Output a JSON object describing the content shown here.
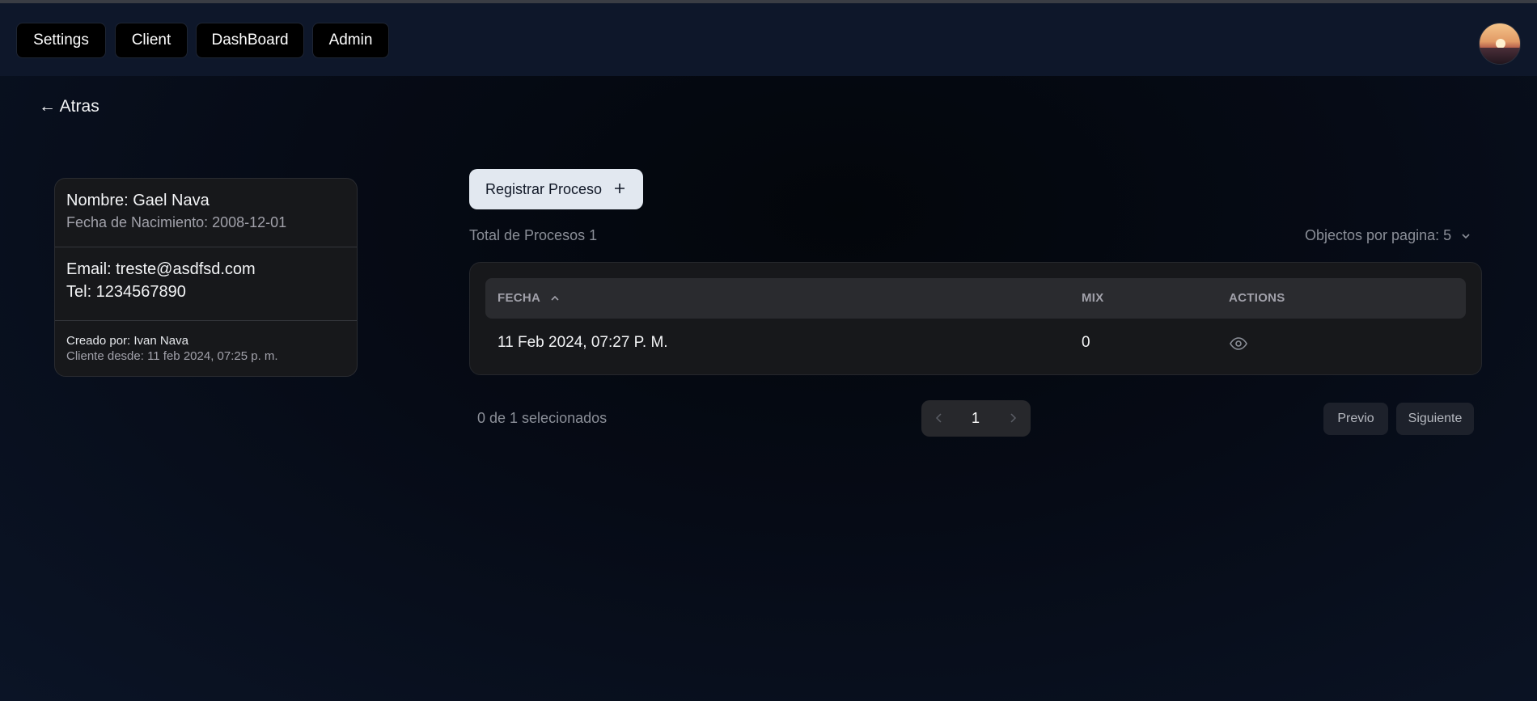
{
  "nav": {
    "buttons": [
      "Settings",
      "Client",
      "DashBoard",
      "Admin"
    ]
  },
  "back_link": "← Atras",
  "client_card": {
    "nombre": "Nombre: Gael Nava",
    "fecha_nacimiento": "Fecha de Nacimiento: 2008-12-01",
    "email": "Email: treste@asdfsd.com",
    "tel": "Tel: 1234567890",
    "creado_por": "Creado por: Ivan Nava",
    "cliente_desde": "Cliente desde: 11 feb 2024, 07:25 p. m."
  },
  "register_button": {
    "label": "Registrar Proceso",
    "icon": "plus-icon"
  },
  "total_label": "Total de Procesos 1",
  "per_page_label": "Objectos por pagina: 5",
  "table": {
    "headers": {
      "fecha": "FECHA",
      "mix": "MIX",
      "actions": "ACTIONS"
    },
    "sort": "ascending",
    "rows": [
      {
        "fecha": "11 Feb 2024, 07:27 P. M.",
        "mix": "0",
        "action_icon": "eye-icon"
      }
    ]
  },
  "selected_label": "0 de 1 selecionados",
  "pagination": {
    "current_page": "1",
    "prev": "Previo",
    "next": "Siguiente"
  },
  "colors": {
    "background": "#060b16",
    "navbar": "#0e172a",
    "card": "#17181b",
    "register_button": "#e2e8f0"
  }
}
